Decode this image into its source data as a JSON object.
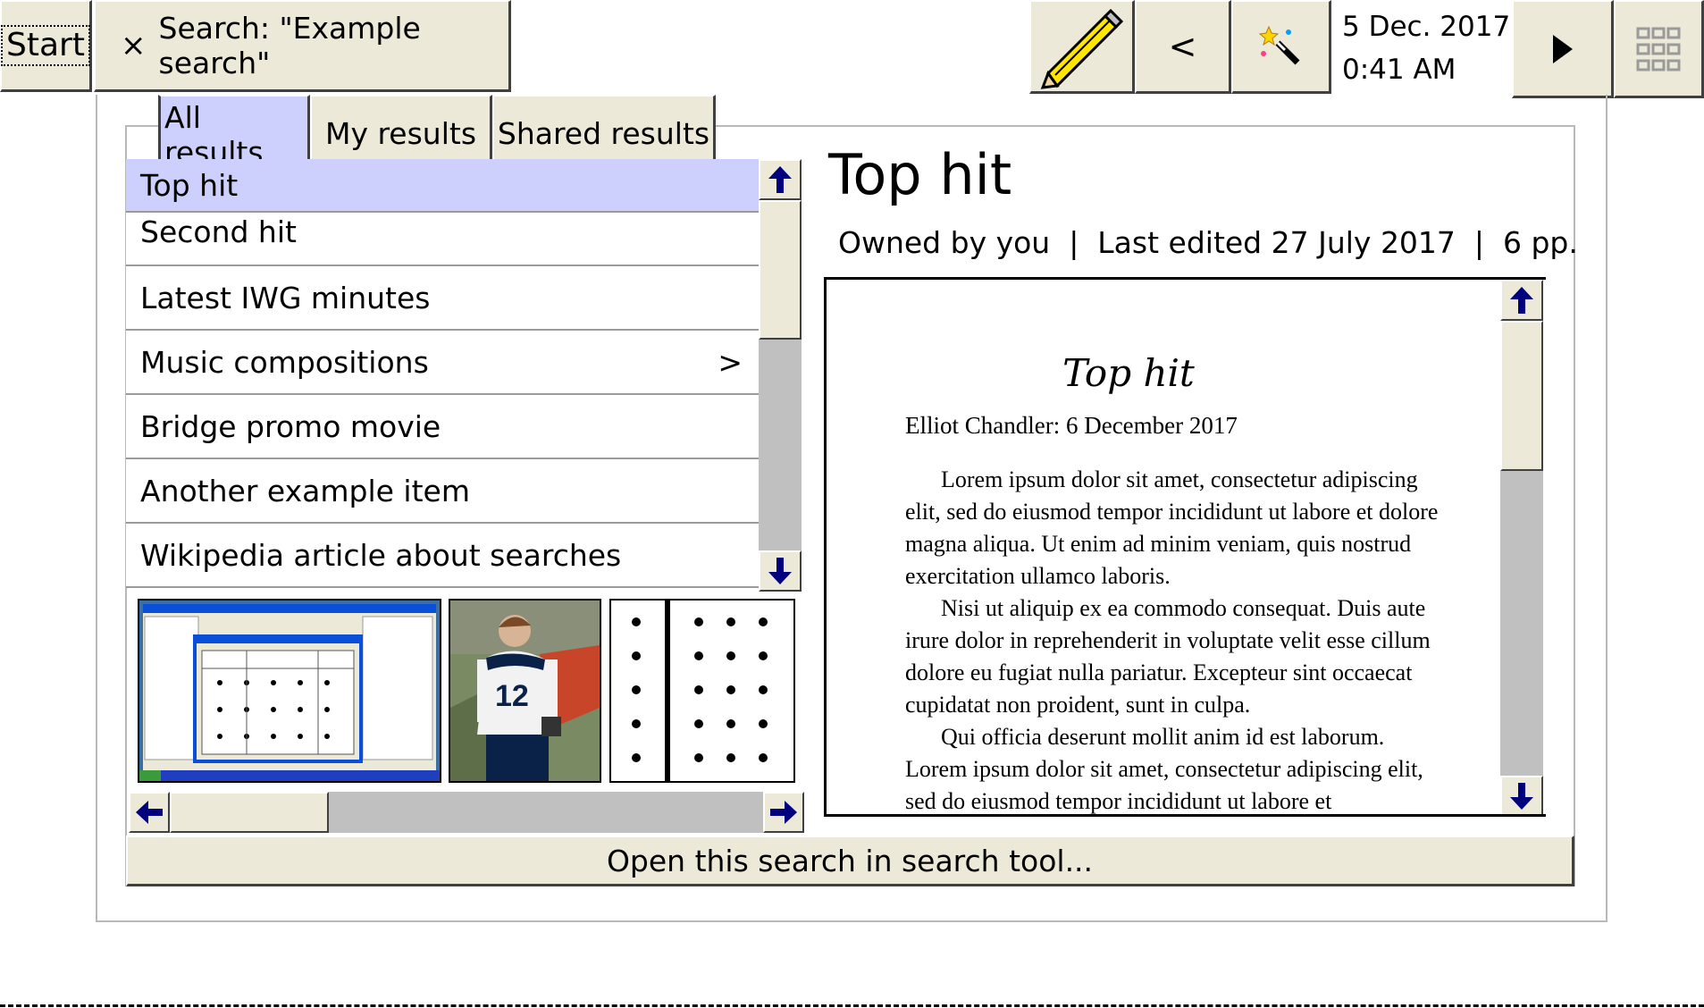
{
  "toolbar": {
    "start_label": "Start",
    "search_chip": {
      "close_symbol": "×",
      "label": "Search: \"Example search\""
    },
    "back_label": "<",
    "clock": {
      "date": "5 Dec. 2017",
      "time": "0:41 AM"
    }
  },
  "tabs": [
    {
      "label": "All results",
      "selected": true
    },
    {
      "label": "My results",
      "selected": false
    },
    {
      "label": "Shared results",
      "selected": false
    }
  ],
  "results": [
    {
      "label": "Top hit",
      "selected": true
    },
    {
      "label": "Second hit"
    },
    {
      "label": "Latest IWG minutes"
    },
    {
      "label": "Music compositions",
      "submenu": ">"
    },
    {
      "label": "Bridge promo movie"
    },
    {
      "label": "Another example item"
    },
    {
      "label": "Wikipedia article about searches"
    }
  ],
  "preview": {
    "title": "Top hit",
    "meta": "Owned by you  |  Last edited 27 July 2017  |  6 pp.",
    "document": {
      "title": "Top hit",
      "byline": "Elliot Chandler: 6 December 2017",
      "paragraphs": [
        "Lorem ipsum dolor sit amet, consectetur adipiscing elit, sed do eiusmod tempor incididunt ut labore et dolore magna aliqua. Ut enim ad minim veniam, quis nostrud exercitation ullamco laboris.",
        "Nisi ut aliquip ex ea commodo consequat. Duis aute irure dolor in reprehenderit in voluptate velit esse cillum dolore eu fugiat nulla pariatur. Excepteur sint occaecat cupidatat non proident, sunt in culpa.",
        "Qui officia deserunt mollit anim id est laborum. Lorem ipsum dolor sit amet, consectetur adipiscing elit, sed do eiusmod tempor incididunt ut labore et"
      ]
    }
  },
  "thumbnails": {
    "photo_number": "12"
  },
  "open_button_label": "Open this search in search tool...",
  "colors": {
    "chrome": "#ece9d8",
    "selection": "#cdd0fc",
    "scroll_arrow": "#00007f",
    "pencil": "#ffe600"
  },
  "icons": [
    "pencil-icon",
    "magic-wand-icon",
    "play-arrow-icon",
    "grid-icon",
    "arrow-up-icon",
    "arrow-down-icon",
    "arrow-left-icon",
    "arrow-right-icon"
  ]
}
